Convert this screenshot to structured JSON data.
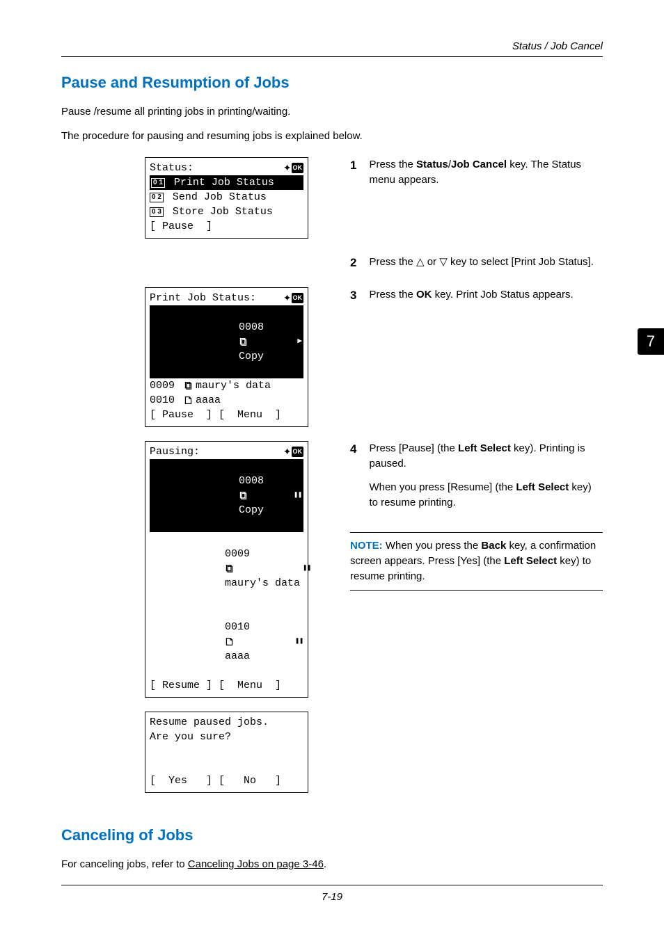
{
  "header": {
    "section": "Status / Job Cancel"
  },
  "sidetab": "7",
  "sec1": {
    "title": "Pause and Resumption of Jobs",
    "p1": "Pause /resume all printing jobs in printing/waiting.",
    "p2": "The procedure for pausing and resuming jobs is explained below."
  },
  "lcd1": {
    "title": "Status:",
    "n1": "0 1",
    "row1": " Print Job Status",
    "n2": "0 2",
    "row2": " Send Job Status",
    "n3": "0 3",
    "row3": " Store Job Status",
    "footer": "[ Pause  ]"
  },
  "lcd2": {
    "title": "Print Job Status:",
    "r1a": "0008 ",
    "r1b": "Copy",
    "r2a": "0009 ",
    "r2b": "maury's data",
    "r3a": "0010 ",
    "r3b": "aaaa",
    "footer": "[ Pause  ] [  Menu  ]"
  },
  "lcd3": {
    "title": "Pausing:",
    "r1a": "0008 ",
    "r1b": "Copy",
    "r2a": "0009 ",
    "r2b": "maury's data",
    "r3a": "0010 ",
    "r3b": "aaaa",
    "footerL": "[ Resume ] [  Menu  ]",
    "pauseIcon": "❚❚",
    "playIcon": "▶"
  },
  "lcd4": {
    "l1": "Resume paused jobs.",
    "l2": "Are you sure?",
    "footer": "[  Yes   ] [   No   ]"
  },
  "steps": {
    "s1n": "1",
    "s1a": "Press the ",
    "s1b": "Status",
    "s1c": "/",
    "s1d": "Job Cancel",
    "s1e": " key. The Status menu appears.",
    "s2n": "2",
    "s2a": "Press the ",
    "s2b": " or ",
    "s2c": " key to select [Print Job Status].",
    "s3n": "3",
    "s3a": "Press the ",
    "s3b": "OK",
    "s3c": " key. Print Job Status appears.",
    "s4n": "4",
    "s4a": "Press [Pause] (the ",
    "s4b": "Left Select",
    "s4c": " key). Printing is paused.",
    "s4d": "When you press [Resume] (the ",
    "s4e": "Left Select",
    "s4f": " key) to resume printing."
  },
  "note": {
    "label": "NOTE:",
    "a": " When you press the ",
    "b": "Back",
    "c": " key, a confirmation screen appears. Press [Yes] (the ",
    "d": "Left Select",
    "e": " key) to resume printing."
  },
  "sec2": {
    "title": "Canceling of Jobs",
    "a": "For canceling jobs, refer to ",
    "link": "Canceling Jobs on page 3-46",
    "b": "."
  },
  "footer_page": "7-19"
}
